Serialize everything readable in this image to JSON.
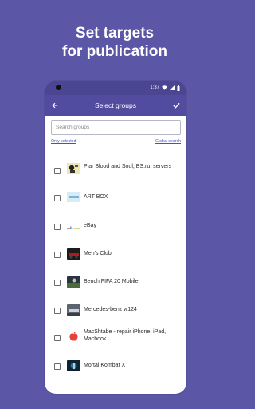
{
  "headline": {
    "line1": "Set targets",
    "line2": "for publication"
  },
  "statusbar": {
    "time": "1:37"
  },
  "appbar": {
    "title": "Select groups",
    "back_icon": "arrow-left-icon",
    "confirm_icon": "check-icon"
  },
  "search": {
    "placeholder": "Search groups"
  },
  "filters": {
    "only_selected": "Only selected",
    "global_search": "Global search"
  },
  "groups": [
    {
      "label": "Piar Blood and Soul, BS.ru, servers",
      "checked": false,
      "thumb": "skull-banner"
    },
    {
      "label": "ART BOX",
      "checked": false,
      "thumb": "artbox-logo"
    },
    {
      "label": "eBay",
      "checked": false,
      "thumb": "ebay-logo"
    },
    {
      "label": "Men's Club",
      "checked": false,
      "thumb": "car-photo"
    },
    {
      "label": "Bench  FIFA 20 Mobile",
      "checked": false,
      "thumb": "fifa-banner"
    },
    {
      "label": "Mercedes-benz w124",
      "checked": false,
      "thumb": "mercedes-photo"
    },
    {
      "label": "MacShtabe - repair iPhone, iPad, Macbook",
      "checked": false,
      "thumb": "apple-logo"
    },
    {
      "label": "Mortal Kombat X",
      "checked": false,
      "thumb": "mk-banner"
    }
  ],
  "colors": {
    "background": "#5b56a6",
    "appbar": "#524ca0",
    "statusbar": "#4a4691",
    "link": "#3b52d6"
  }
}
